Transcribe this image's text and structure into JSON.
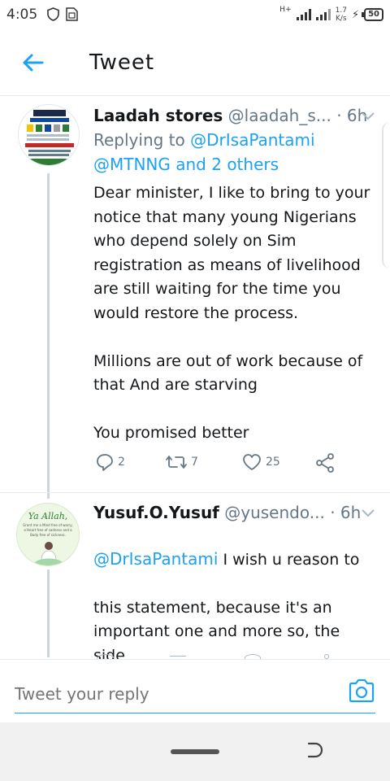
{
  "status": {
    "time": "4:05",
    "network_type": "H+",
    "speed_value": "1.7",
    "speed_unit": "K/s",
    "battery": "50"
  },
  "header": {
    "title": "Tweet"
  },
  "tweets": [
    {
      "author": "Laadah stores",
      "handle": "@laadah_s...",
      "separator": "·",
      "time": "6h",
      "replying_prefix": "Replying to",
      "replying_mention": "@DrIsaPantami",
      "replying_rest": "@MTNNG and 2 others",
      "text": "Dear minister, I like to bring to your\nnotice that many young Nigerians\nwho depend solely on Sim\nregistration as means of livelihood\nare still waiting for the time you\nwould restore the process.\n\nMillions are out of work because of\nthat And are starving\n\nYou promised better",
      "replies": "2",
      "retweets": "7",
      "likes": "25"
    },
    {
      "author": "Yusuf.O.Yusuf",
      "handle": "@yusendo...",
      "separator": "·",
      "time": "6h",
      "mention": "@DrIsaPantami",
      "text_first": " I wish u reason to",
      "text": "this statement, because it's an\nimportant one and more so, the side\neffect May latter affect every\nNigerians including ur family.",
      "avatar_text_1": "Ya Allah,",
      "avatar_text_2": "Grant me a Mind free of worry, a Heart free of sadness and a Body free of sickness."
    }
  ],
  "reply": {
    "placeholder": "Tweet your reply"
  },
  "colors": {
    "accent": "#1da1f2",
    "muted": "#657786",
    "text": "#14171a"
  }
}
